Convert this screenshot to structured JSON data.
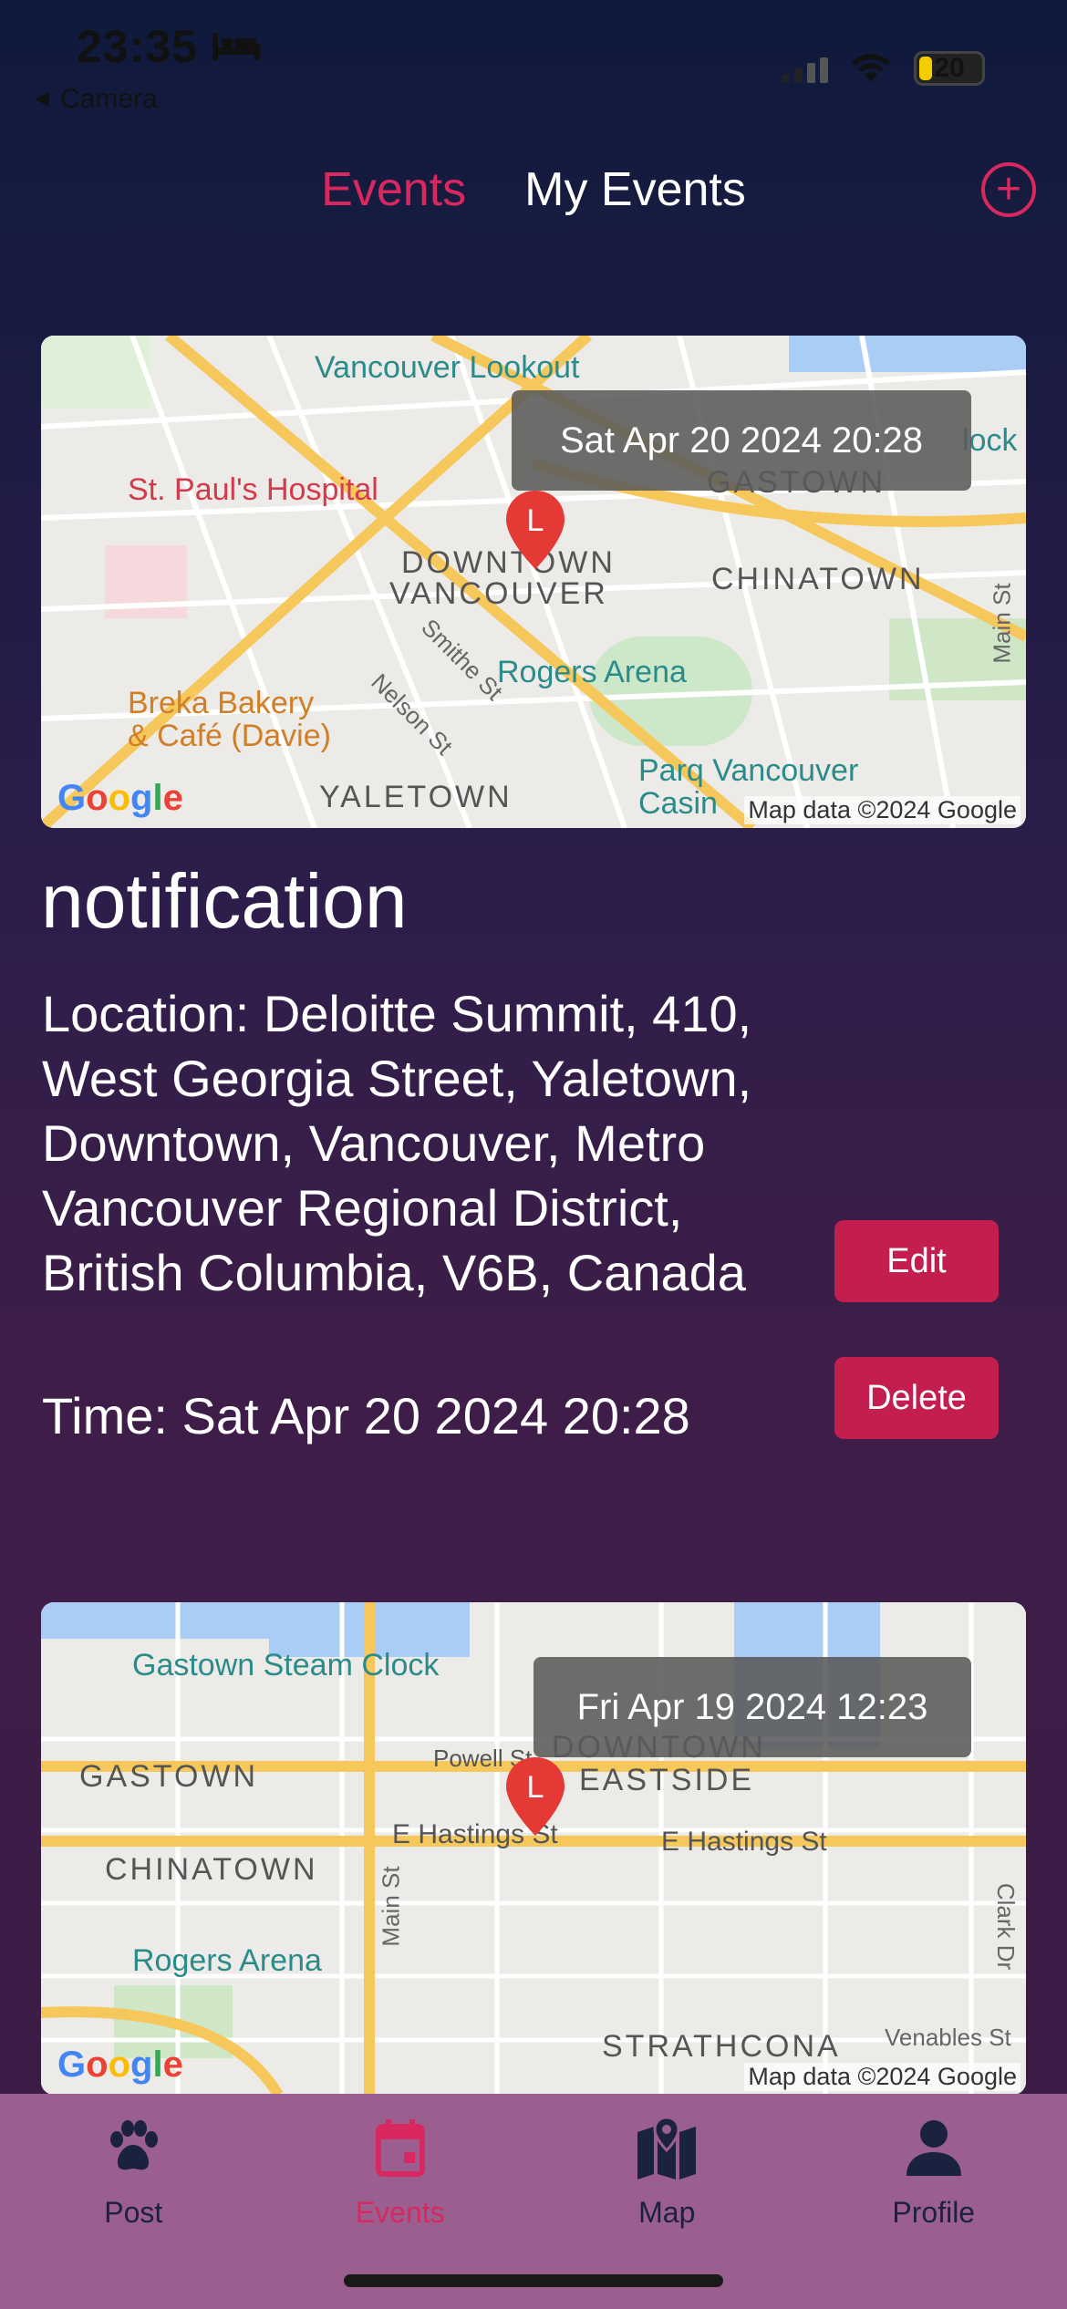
{
  "status_bar": {
    "time": "23:35",
    "back_label": "Camera",
    "battery": "20"
  },
  "top_tabs": {
    "events": "Events",
    "my_events": "My Events"
  },
  "events": [
    {
      "map_time": "Sat Apr 20 2024 20:28",
      "map_labels": {
        "l1": "Vancouver Lookout",
        "l2": "St. Paul's Hospital",
        "l3": "GASTOWN",
        "l4": "DOWNTOWN",
        "l5": "VANCOUVER",
        "l6": "CHINATOWN",
        "l7": "Rogers Arena",
        "l8": "Breka Bakery",
        "l9": "& Café (Davie)",
        "l10": "YALETOWN",
        "l11": "Parq Vancouver",
        "l12": "Casin",
        "l13": "Smithe St",
        "l14": "Nelson St",
        "l15": "Main St",
        "l16": "lock"
      },
      "attribution": "Map data ©2024 Google",
      "title": "notification",
      "location": "Location: Deloitte Summit, 410, West Georgia Street, Yaletown, Downtown, Vancouver, Metro Vancouver Regional District, British Columbia, V6B, Canada",
      "time": "Time: Sat Apr 20 2024 20:28",
      "edit_label": "Edit",
      "delete_label": "Delete"
    },
    {
      "map_time": "Fri Apr 19 2024 12:23",
      "map_labels": {
        "l1": "Gastown Steam Clock",
        "l2": "GASTOWN",
        "l3": "Powell St",
        "l4": "DOWNTOWN",
        "l5": "EASTSIDE",
        "l6": "E Hastings St",
        "l7": "E Hastings St",
        "l8": "CHINATOWN",
        "l9": "Rogers Arena",
        "l10": "Main St",
        "l11": "STRATHCONA",
        "l12": "Venables St",
        "l13": "Clark Dr"
      },
      "attribution": "Map data ©2024 Google"
    }
  ],
  "bottom_nav": {
    "post": "Post",
    "events": "Events",
    "map": "Map",
    "profile": "Profile"
  },
  "colors": {
    "accent": "#d8285f",
    "button": "#c41e4f",
    "nav_bg": "#9a5e8f"
  }
}
